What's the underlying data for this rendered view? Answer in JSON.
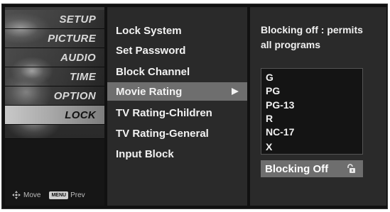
{
  "tabs": [
    {
      "label": "SETUP",
      "icon": "satellite-dish-icon"
    },
    {
      "label": "PICTURE",
      "icon": "picture-icon"
    },
    {
      "label": "AUDIO",
      "icon": "speaker-icon"
    },
    {
      "label": "TIME",
      "icon": "clock-icon"
    },
    {
      "label": "OPTION",
      "icon": "option-icon"
    },
    {
      "label": "LOCK",
      "icon": "lock-tab-icon",
      "active": true
    }
  ],
  "footer": {
    "move_label": "Move",
    "menu_key": "MENU",
    "prev_label": "Prev"
  },
  "menu": {
    "items": [
      "Lock System",
      "Set Password",
      "Block Channel",
      "Movie Rating",
      "TV Rating-Children",
      "TV Rating-General",
      "Input Block"
    ],
    "selected": "Movie Rating"
  },
  "detail": {
    "description_line1": "Blocking off : permits",
    "description_line2": "all programs",
    "ratings": [
      "G",
      "PG",
      "PG-13",
      "R",
      "NC-17",
      "X"
    ],
    "current_value": "Blocking Off",
    "current_value_icon": "unlocked-padlock-icon"
  }
}
